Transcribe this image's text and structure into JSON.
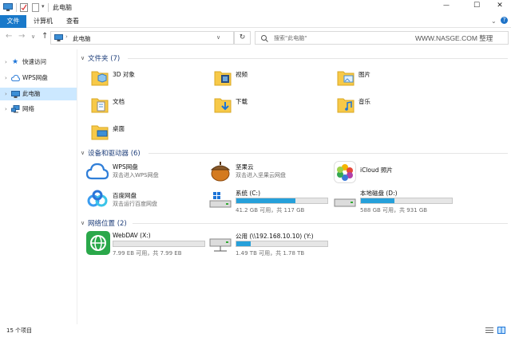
{
  "window": {
    "title": "此电脑",
    "min": "—",
    "max": "☐",
    "close": "✕"
  },
  "ribbon": {
    "tabs": [
      "文件",
      "计算机",
      "查看"
    ]
  },
  "nav": {
    "path": "此电脑",
    "search_placeholder": "搜索\"此电脑\"",
    "watermark": "WWW.NASGE.COM 整理"
  },
  "sidebar": {
    "items": [
      {
        "label": "快速访问"
      },
      {
        "label": "WPS网盘"
      },
      {
        "label": "此电脑"
      },
      {
        "label": "网络"
      }
    ]
  },
  "groups": {
    "folders": {
      "title": "文件夹 (7)",
      "items": [
        "3D 对象",
        "视频",
        "图片",
        "文档",
        "下载",
        "音乐",
        "桌面"
      ]
    },
    "devices": {
      "title": "设备和驱动器 (6)"
    },
    "network": {
      "title": "网络位置 (2)"
    }
  },
  "devices": [
    {
      "name": "WPS网盘",
      "sub": "双击进入WPS网盘"
    },
    {
      "name": "坚果云",
      "sub": "双击进入坚果云网盘"
    },
    {
      "name": "iCloud 照片",
      "sub": ""
    },
    {
      "name": "百度网盘",
      "sub": "双击运行百度网盘"
    },
    {
      "name": "系统 (C:)",
      "sub": "41.2 GB 可用，共 117 GB",
      "used": 0.65
    },
    {
      "name": "本地磁盘 (D:)",
      "sub": "588 GB 可用，共 931 GB",
      "used": 0.37
    }
  ],
  "network": [
    {
      "name": "WebDAV (X:)",
      "sub": "7.99 EB 可用，共 7.99 EB",
      "used": 0.0
    },
    {
      "name": "公用 (\\\\192.168.10.10) (Y:)",
      "sub": "1.49 TB 可用，共 1.78 TB",
      "used": 0.16
    }
  ],
  "status": {
    "count": "15 个项目"
  },
  "colors": {
    "accent": "#26a0da",
    "file_tab": "#1979ca",
    "selected": "#cce8ff",
    "folder": "#f7c948"
  }
}
